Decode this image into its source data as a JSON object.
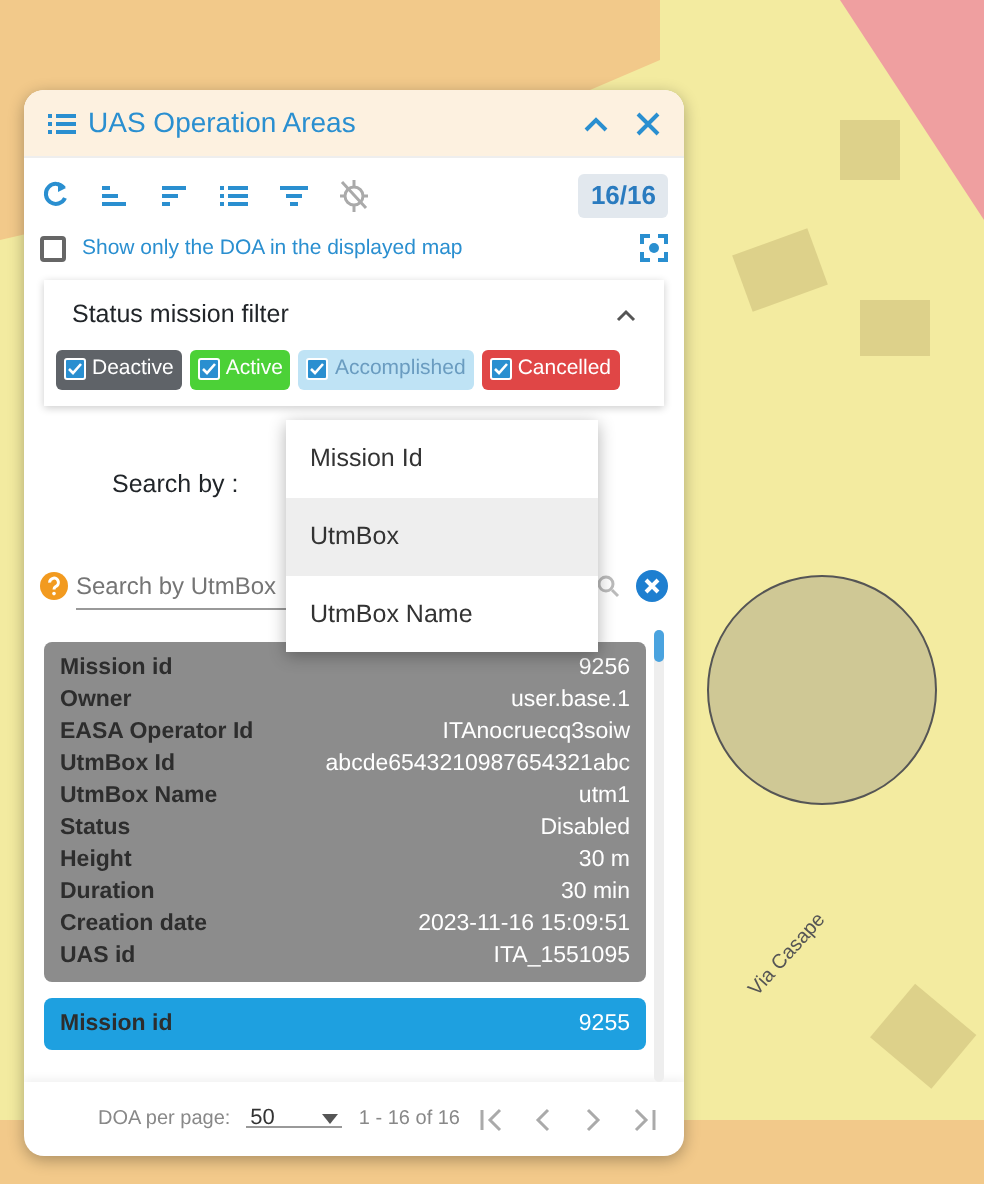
{
  "map": {
    "street_label": "Via Casape"
  },
  "panel": {
    "title": "UAS Operation Areas",
    "count": "16/16",
    "show_only_doa": {
      "label": "Show only the DOA in the displayed map",
      "checked": false
    },
    "status_filter": {
      "title": "Status mission filter",
      "expanded": true,
      "chips": [
        {
          "label": "Deactive",
          "checked": true,
          "color": "#5f6368"
        },
        {
          "label": "Active",
          "checked": true,
          "color": "#4cd137"
        },
        {
          "label": "Accomplished",
          "checked": true,
          "color": "#bfe3f5"
        },
        {
          "label": "Cancelled",
          "checked": true,
          "color": "#e04646"
        }
      ]
    },
    "search_by": {
      "label": "Search by :",
      "placeholder": "Search by UtmBox"
    },
    "menu": [
      {
        "label": "Mission Id",
        "selected": false
      },
      {
        "label": "UtmBox",
        "selected": true
      },
      {
        "label": "UtmBox Name",
        "selected": false
      }
    ],
    "missions": [
      {
        "color": "#8c8c8c",
        "rows": [
          [
            "Mission id",
            "9256"
          ],
          [
            "Owner",
            "user.base.1"
          ],
          [
            "EASA Operator Id",
            "ITAnocruecq3soiw"
          ],
          [
            "UtmBox Id",
            "abcde6543210987654321abc"
          ],
          [
            "UtmBox Name",
            "utm1"
          ],
          [
            "Status",
            "Disabled"
          ],
          [
            "Height",
            "30 m"
          ],
          [
            "Duration",
            "30 min"
          ],
          [
            "Creation date",
            "2023-11-16 15:09:51"
          ],
          [
            "UAS id",
            "ITA_1551095"
          ]
        ]
      },
      {
        "color": "#1ea0e0",
        "rows": [
          [
            "Mission id",
            "9255"
          ]
        ]
      }
    ],
    "paginator": {
      "label": "DOA per page:",
      "page_size": "50",
      "range": "1 - 16 of 16"
    }
  }
}
